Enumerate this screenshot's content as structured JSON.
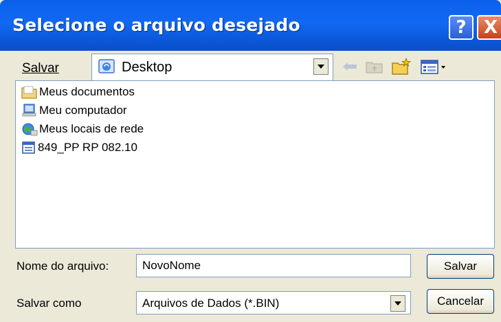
{
  "window": {
    "title": "Selecione o arquivo desejado",
    "help_label": "?",
    "close_label": "X"
  },
  "toolbar": {
    "save_in_label": "Salvar",
    "location": "Desktop",
    "icons": [
      "back-icon",
      "up-folder-icon",
      "new-folder-icon",
      "view-menu-icon"
    ]
  },
  "files": [
    {
      "name": "Meus documentos",
      "icon": "my-documents-icon"
    },
    {
      "name": "Meu computador",
      "icon": "my-computer-icon"
    },
    {
      "name": "Meus locais de rede",
      "icon": "network-places-icon"
    },
    {
      "name": "849_PP RP 082.10",
      "icon": "data-file-icon"
    }
  ],
  "form": {
    "filename_label": "Nome do arquivo:",
    "filename_value": "NovoNome",
    "type_label": "Salvar como",
    "type_value": "Arquivos de Dados (*.BIN)"
  },
  "buttons": {
    "save": "Salvar",
    "cancel": "Cancelar"
  },
  "colors": {
    "titlebar": "#0b5be3",
    "window_bg": "#ece9d8",
    "close_button": "#d2522c"
  }
}
